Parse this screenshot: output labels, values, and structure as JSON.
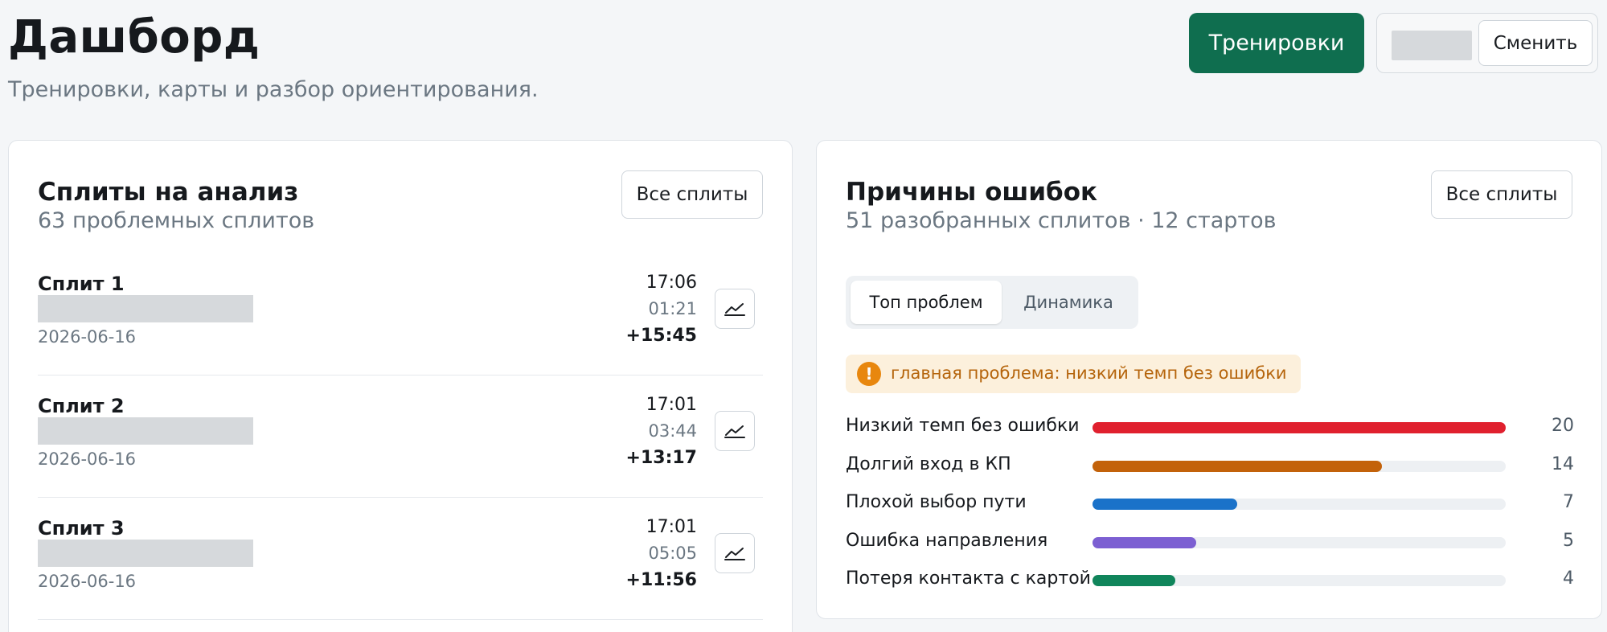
{
  "header": {
    "title": "Дашборд",
    "subtitle": "Тренировки, карты и разбор ориентирования.",
    "primary_button": "Тренировки",
    "switch_button": "Сменить"
  },
  "splits_card": {
    "title": "Сплиты на анализ",
    "subtitle": "63 проблемных сплитов",
    "all_button": "Все сплиты",
    "items": [
      {
        "name": "Сплит 1",
        "date": "2026-06-16",
        "time": "17:06",
        "split": "01:21",
        "delta": "+15:45"
      },
      {
        "name": "Сплит 2",
        "date": "2026-06-16",
        "time": "17:01",
        "split": "03:44",
        "delta": "+13:17"
      },
      {
        "name": "Сплит 3",
        "date": "2026-06-16",
        "time": "17:01",
        "split": "05:05",
        "delta": "+11:56"
      }
    ]
  },
  "errors_card": {
    "title": "Причины ошибок",
    "subtitle": "51 разобранных сплитов · 12 стартов",
    "all_button": "Все сплиты",
    "tabs": [
      "Топ проблем",
      "Динамика"
    ],
    "active_tab": "Топ проблем",
    "alert_icon": "exclamation-icon",
    "alert_text": "главная проблема: низкий темп без ошибки",
    "max_count": 20,
    "reasons": [
      {
        "label": "Низкий темп без ошибки",
        "count": 20,
        "color": "#e0202e"
      },
      {
        "label": "Долгий вход в КП",
        "count": 14,
        "color": "#c3620a"
      },
      {
        "label": "Плохой выбор пути",
        "count": 7,
        "color": "#1a72c9"
      },
      {
        "label": "Ошибка направления",
        "count": 5,
        "color": "#7c5fd2"
      },
      {
        "label": "Потеря контакта с картой",
        "count": 4,
        "color": "#10855b"
      }
    ]
  }
}
